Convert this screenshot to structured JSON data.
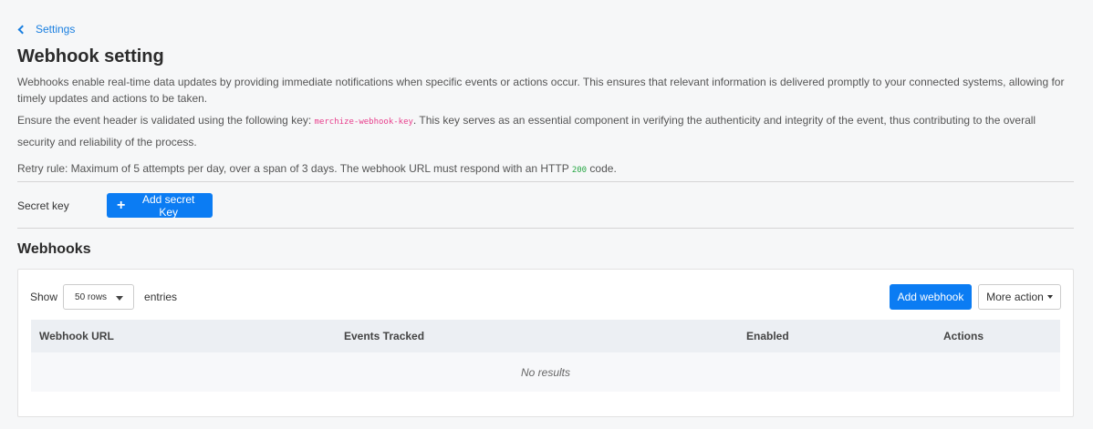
{
  "breadcrumb": {
    "label": "Settings"
  },
  "page": {
    "title": "Webhook setting",
    "description": "Webhooks enable real-time data updates by providing immediate notifications when specific events or actions occur. This ensures that relevant information is delivered promptly to your connected systems, allowing for timely updates and actions to be taken.",
    "header_note_before": "Ensure the event header is validated using the following key: ",
    "header_key": "merchize-webhook-key",
    "header_note_after": ". This key serves as an essential component in verifying the authenticity and integrity of the event, thus contributing to the overall security and reliability of the process.",
    "retry_before": "Retry rule: Maximum of 5 attempts per day, over a span of 3 days. The webhook URL must respond with an HTTP ",
    "retry_code": "200",
    "retry_after": " code."
  },
  "secret": {
    "label": "Secret key",
    "button_label": "Add secret Key",
    "button_icon": "plus-icon"
  },
  "webhooks": {
    "section_title": "Webhooks",
    "show_label": "Show",
    "rows_selected": "50 rows",
    "entries_label": "entries",
    "add_button": "Add webhook",
    "more_button": "More action",
    "columns": [
      "Webhook URL",
      "Events Tracked",
      "Enabled",
      "Actions"
    ],
    "empty_text": "No results"
  },
  "colors": {
    "accent": "#0b7cf3",
    "link": "#1a7fe0",
    "code_key": "#e83e8c",
    "code_ok": "#28a745"
  }
}
